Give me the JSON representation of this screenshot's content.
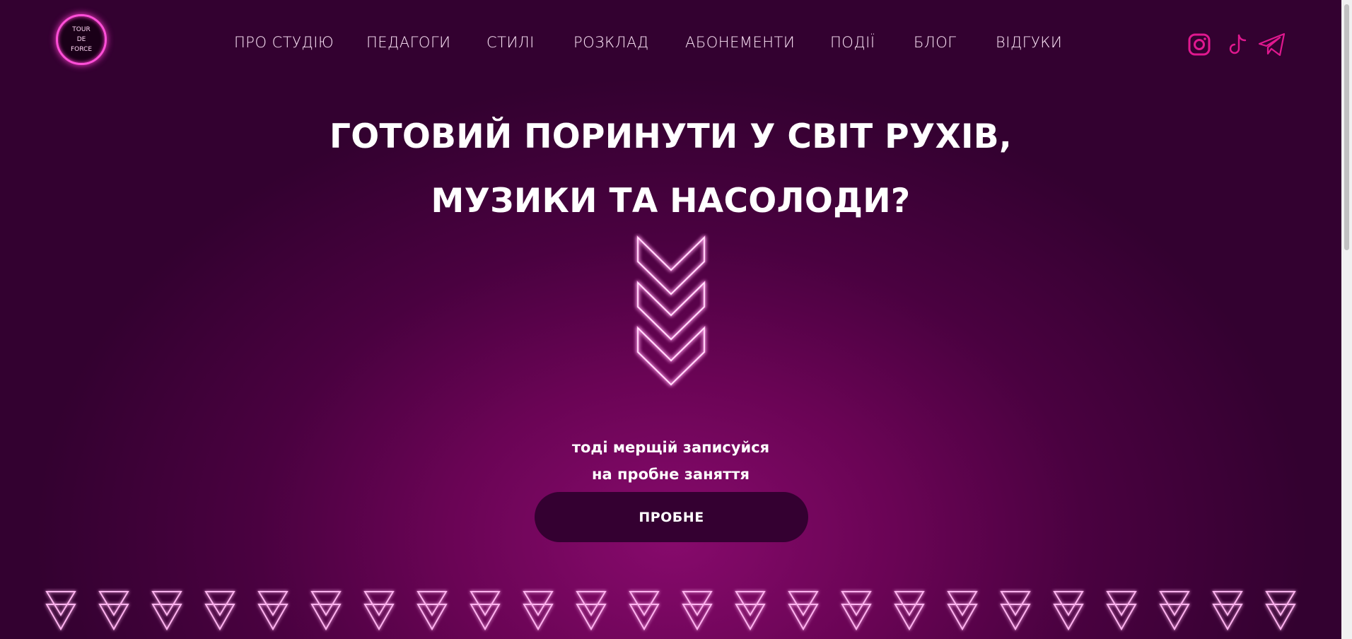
{
  "logo": {
    "lines": [
      "TOUR",
      "DE",
      "FORCE"
    ]
  },
  "nav": {
    "items": [
      "ПРО СТУДІЮ",
      "ПЕДАГОГИ",
      "СТИЛІ",
      "РОЗКЛАД",
      "АБОНЕМЕНТИ",
      "ПОДІЇ",
      "БЛОГ",
      "ВІДГУКИ"
    ]
  },
  "social": {
    "icons": [
      "instagram-icon",
      "tiktok-icon",
      "telegram-icon"
    ]
  },
  "hero": {
    "title_line1": "ГОТОВИЙ ПОРИНУТИ У СВІТ РУХІВ,",
    "title_line2": "МУЗИКИ ТА НАСОЛОДИ?",
    "subtitle_line1": "тоді мерщій записуйся",
    "subtitle_line2": "на пробне заняття",
    "cta_label": "ПРОБНЕ"
  },
  "colors": {
    "accent": "#ff3ccf",
    "button_bg": "#340031",
    "background": "#4a0140"
  }
}
